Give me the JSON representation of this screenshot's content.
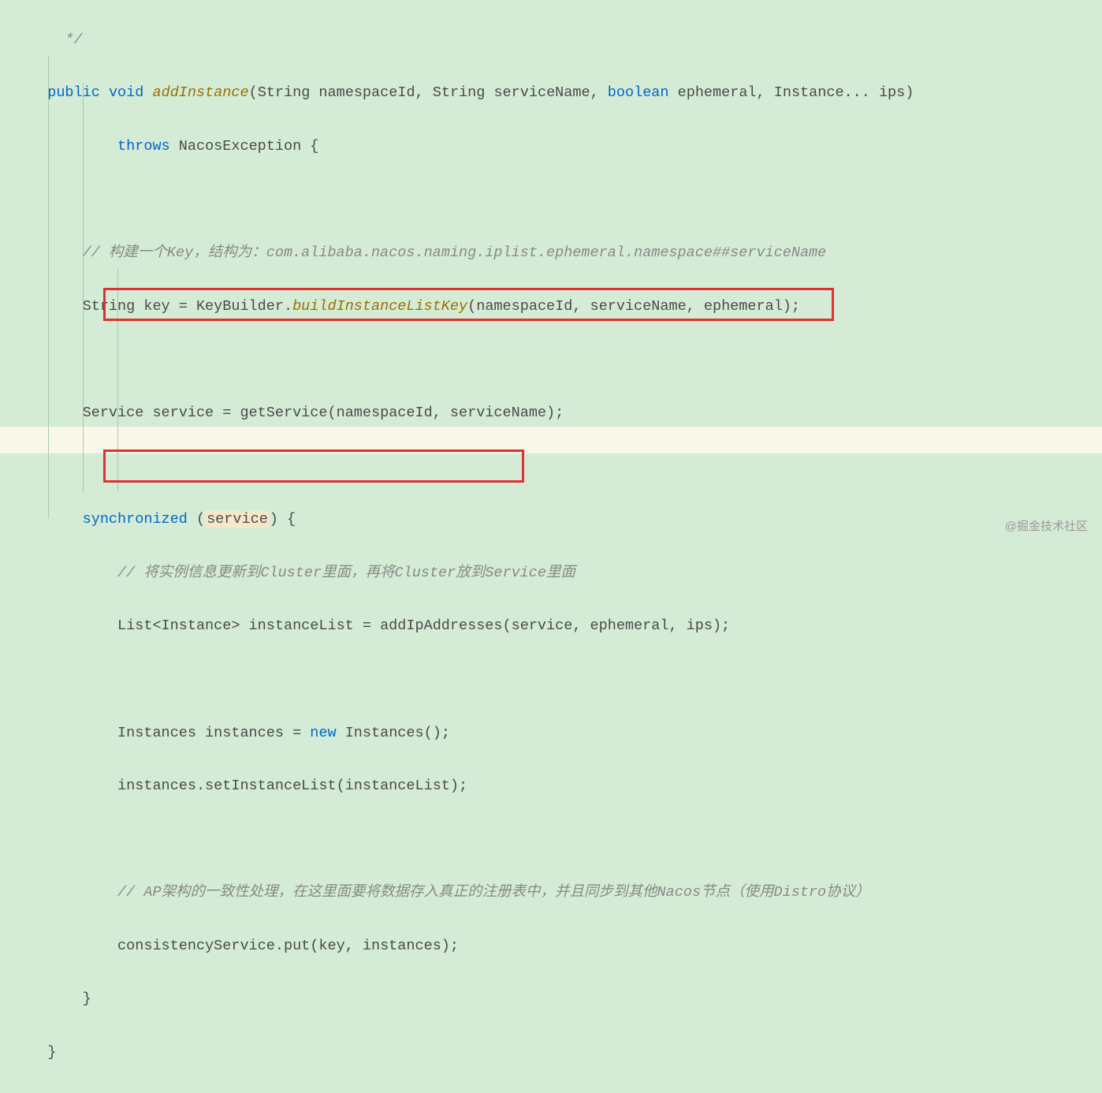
{
  "code": {
    "commentClose": " */",
    "sig1_public": "public",
    "sig1_void": "void",
    "sig1_name": "addInstance",
    "sig1_params": "(String namespaceId, String serviceName, ",
    "sig1_boolean": "boolean",
    "sig1_rest": " ephemeral, Instance... ips)",
    "throws_kw": "throws",
    "throws_rest": " NacosException {",
    "comment1": "// 构建一个Key，结构为：com.alibaba.nacos.naming.iplist.ephemeral.namespace##serviceName",
    "line_key": "String key = KeyBuilder.",
    "line_key_method": "buildInstanceListKey",
    "line_key_rest": "(namespaceId, serviceName, ephemeral);",
    "line_service": "Service service = getService(namespaceId, serviceName);",
    "sync_kw": "synchronized",
    "sync_open": " (",
    "sync_var": "service",
    "sync_close": ") {",
    "comment2": "// 将实例信息更新到Cluster里面，再将Cluster放到Service里面",
    "line_list": "List<Instance> instanceList = addIpAddresses(service, ephemeral, ips);",
    "line_inst1a": "Instances instances = ",
    "line_inst1_new": "new",
    "line_inst1b": " Instances();",
    "line_inst2": "instances.setInstanceList(instanceList);",
    "comment3": "// AP架构的一致性处理，在这里面要将数据存入真正的注册表中，并且同步到其他Nacos节点（使用Distro协议）",
    "line_put": "consistencyService.put(key, instances);",
    "close1": "}",
    "close2": "}"
  },
  "watermark": "@掘金技术社区"
}
